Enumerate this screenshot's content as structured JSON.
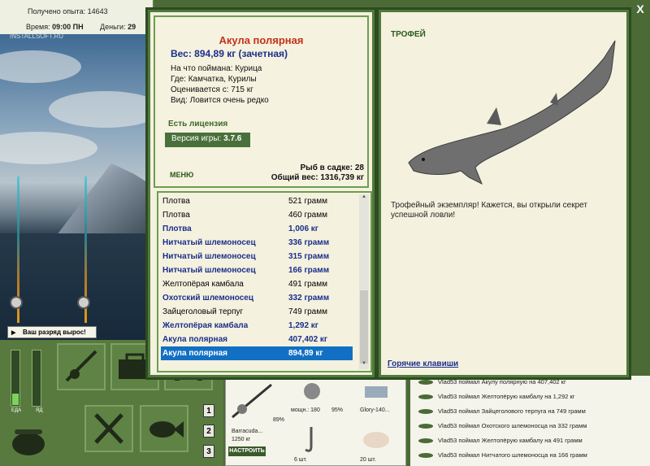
{
  "topbar": {
    "exp_label": "Получено опыта:",
    "exp_value": "14643",
    "time_label": "Время:",
    "time_value": "09:00 ПН",
    "money_label": "Деньги:",
    "money_value": "29"
  },
  "watermark": "INSTALLSOFT.RU",
  "rank_message": "Ваш разряд вырос!",
  "gauges": {
    "food_label": "ЕДА",
    "poison_label": "ЯД"
  },
  "slot_numbers": [
    "1",
    "2",
    "3"
  ],
  "tackle": {
    "rod_name": "Barracuda...",
    "rod_weight": "1250 кг",
    "rod_percent": "89%",
    "line_label": "мощн.: 180",
    "line_percent": "95%",
    "lure_label": "Glory-140...",
    "hooks_count": "6 шт.",
    "bait_count": "20 шт.",
    "tune_button": "НАСТРОИТЬ"
  },
  "feed": [
    "Vlad53 поймал Акулу полярную на 407,402 кг",
    "Vlad53 поймал Желтопёрую камбалу на 1,292 кг",
    "Vlad53 поймал Зайцеголового терпуга на 749 грамм",
    "Vlad53 поймал Охотского шлемоносца на 332 грамм",
    "Vlad53 поймал Желтопёрую камбалу на 491 грамм",
    "Vlad53 поймал Нитчатого шлемоносца на 166 грамм"
  ],
  "fish_info": {
    "name": "Акула полярная",
    "weight": "Вес: 894,89 кг (зачетная)",
    "caught_on": "На что поймана: Курица",
    "where": "Где: Камчатка, Курилы",
    "valued_from": "Оценивается с: 715 кг",
    "rarity": "Вид: Ловится очень редко",
    "license": "Есть лицензия",
    "version_label": "Версия игры:",
    "version_value": "3.7.6",
    "menu_label": "МЕНЮ",
    "cage_count": "Рыб в садке: 28",
    "total_weight": "Общий вес: 1316,739 кг"
  },
  "catch_list": [
    {
      "name": "Плотва",
      "weight": "521 грамм",
      "trophy": false
    },
    {
      "name": "Плотва",
      "weight": "460 грамм",
      "trophy": false
    },
    {
      "name": "Плотва",
      "weight": "1,006 кг",
      "trophy": true
    },
    {
      "name": "Нитчатый шлемоносец",
      "weight": "336 грамм",
      "trophy": true
    },
    {
      "name": "Нитчатый шлемоносец",
      "weight": "315 грамм",
      "trophy": true
    },
    {
      "name": "Нитчатый шлемоносец",
      "weight": "166 грамм",
      "trophy": true
    },
    {
      "name": "Желтопёрая камбала",
      "weight": "491 грамм",
      "trophy": false
    },
    {
      "name": "Охотский шлемоносец",
      "weight": "332 грамм",
      "trophy": true
    },
    {
      "name": "Зайцеголовый терпуг",
      "weight": "749 грамм",
      "trophy": false
    },
    {
      "name": "Желтопёрая камбала",
      "weight": "1,292 кг",
      "trophy": true
    },
    {
      "name": "Акула полярная",
      "weight": "407,402 кг",
      "trophy": true
    },
    {
      "name": "Акула полярная",
      "weight": "894,89 кг",
      "trophy": true,
      "selected": true
    }
  ],
  "trophy": {
    "title": "ТРОФЕЙ",
    "text": "Трофейный экземпляр! Кажется, вы открыли секрет успешной ловли!",
    "hotkeys": "Горячие клавиши"
  },
  "close_label": "X"
}
